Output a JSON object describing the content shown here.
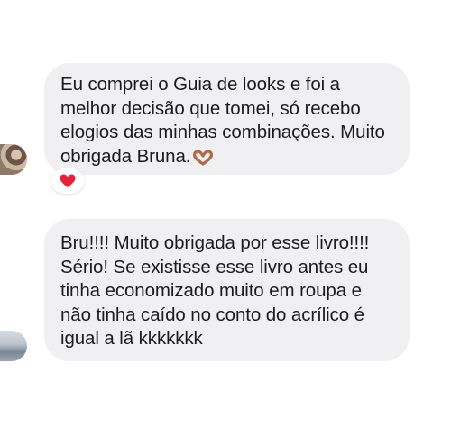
{
  "messages": [
    {
      "lines": [
        "Eu comprei o Guia de looks e foi a",
        "melhor decisão que tomei, só recebo",
        "elogios das minhas combinações. Muito",
        "obrigada Bruna."
      ],
      "emoji": "heart-hands-icon",
      "reaction": "heart-icon"
    },
    {
      "lines": [
        "Bru!!!! Muito obrigada por esse livro!!!!",
        "Sério! Se existisse esse livro antes eu",
        "tinha economizado muito em roupa e",
        "não tinha caído no conto do acrílico é",
        "igual a lã kkkkkkk"
      ]
    }
  ],
  "colors": {
    "bubble": "#f0f0f2",
    "text": "#1c1c1e",
    "heart": "#e8203a",
    "heart_hands": "#b26b45"
  }
}
